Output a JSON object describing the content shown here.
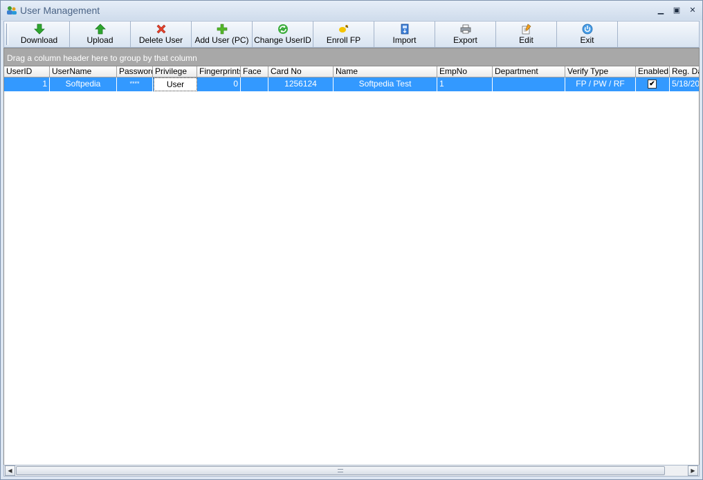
{
  "window": {
    "title": "User Management",
    "minimize": "▁",
    "maximize": "▣",
    "close": "✕"
  },
  "toolbar": {
    "buttons": [
      {
        "label": "Download",
        "icon": "arrow-down-icon"
      },
      {
        "label": "Upload",
        "icon": "arrow-up-icon"
      },
      {
        "label": "Delete User",
        "icon": "delete-x-icon"
      },
      {
        "label": "Add User (PC)",
        "icon": "plus-icon"
      },
      {
        "label": "Change UserID",
        "icon": "refresh-icon"
      },
      {
        "label": "Enroll FP",
        "icon": "fingerprint-key-icon"
      },
      {
        "label": "Import",
        "icon": "import-icon"
      },
      {
        "label": "Export",
        "icon": "printer-icon"
      },
      {
        "label": "Edit",
        "icon": "edit-icon"
      },
      {
        "label": "Exit",
        "icon": "power-icon"
      }
    ]
  },
  "group_panel": {
    "text": "Drag a column header here to group by that column"
  },
  "grid": {
    "columns": [
      "UserID",
      "UserName",
      "Password",
      "Privilege",
      "Fingerprints",
      "Face",
      "Card No",
      "Name",
      "EmpNo",
      "Department",
      "Verify Type",
      "Enabled",
      "Reg. Da"
    ],
    "rows": [
      {
        "userid": "1",
        "username": "Softpedia",
        "password": "****",
        "privilege": "User",
        "fingerprints": "0",
        "face": "",
        "card_no": "1256124",
        "name": "Softpedia Test",
        "empno": "1",
        "department": "",
        "verify_type": "FP / PW / RF",
        "enabled": "✔",
        "reg_date": "5/18/20"
      }
    ]
  },
  "scrollbar": {
    "left": "◀",
    "right": "▶"
  },
  "colors": {
    "selected_row": "#3399ff",
    "group_panel": "#a8a8a8",
    "title_text": "#4a6385"
  }
}
